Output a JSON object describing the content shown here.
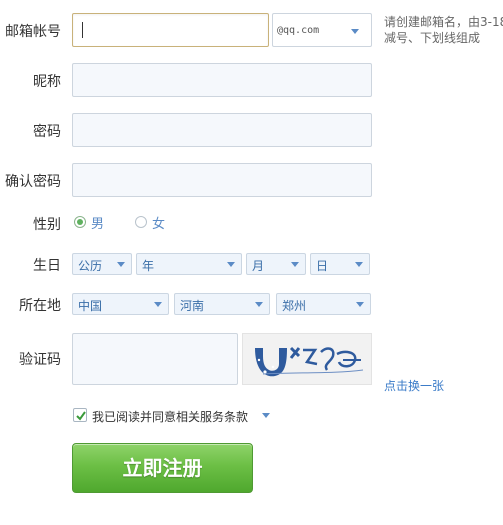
{
  "form": {
    "email": {
      "label": "邮箱帐号",
      "value": "",
      "domain": "@qq.com",
      "hint_line1": "请创建邮箱名，由3-18",
      "hint_line2": "减号、下划线组成"
    },
    "nickname": {
      "label": "昵称",
      "value": ""
    },
    "password": {
      "label": "密码",
      "value": ""
    },
    "confirm_password": {
      "label": "确认密码",
      "value": ""
    },
    "gender": {
      "label": "性别",
      "options": [
        "男",
        "女"
      ],
      "selected": "男"
    },
    "birthday": {
      "label": "生日",
      "calendar": "公历",
      "year": "年",
      "month": "月",
      "day": "日"
    },
    "location": {
      "label": "所在地",
      "country": "中国",
      "province": "河南",
      "city": "郑州"
    },
    "captcha": {
      "label": "验证码",
      "value": "",
      "refresh_link": "点击换一张"
    },
    "agreement": {
      "label": "我已阅读并同意相关服务条款",
      "checked": true
    },
    "submit_label": "立即注册"
  },
  "colors": {
    "accent": "#5b8bc6",
    "button": "#6cbf45",
    "link": "#3a7bc8"
  }
}
